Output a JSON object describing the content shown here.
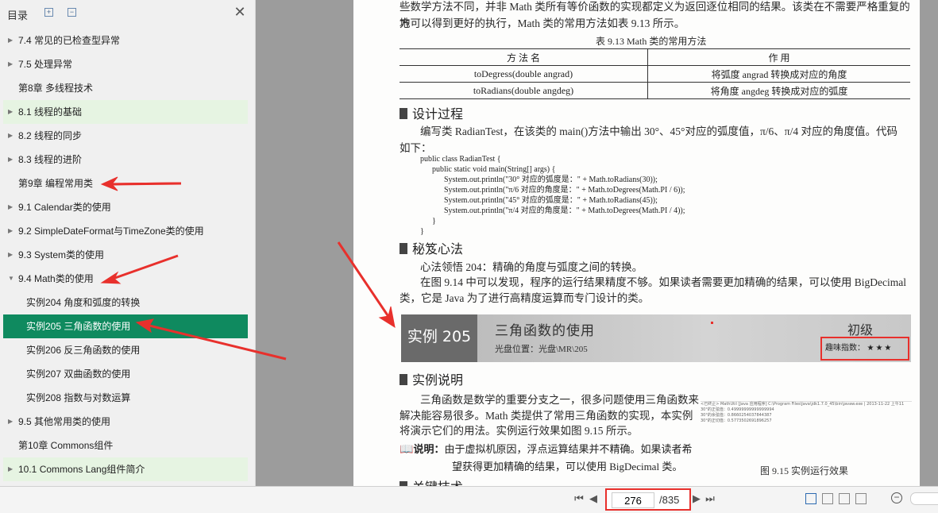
{
  "sidebar": {
    "title": "目录",
    "items": [
      {
        "label": "7.4 常见的已检查型异常",
        "level": 0,
        "caret": true,
        "style": ""
      },
      {
        "label": "7.5 处理异常",
        "level": 0,
        "caret": true,
        "style": ""
      },
      {
        "label": "第8章 多线程技术",
        "level": 0,
        "caret": false,
        "style": ""
      },
      {
        "label": "8.1 线程的基础",
        "level": 0,
        "caret": true,
        "style": "hl"
      },
      {
        "label": "8.2 线程的同步",
        "level": 0,
        "caret": true,
        "style": ""
      },
      {
        "label": "8.3 线程的进阶",
        "level": 0,
        "caret": true,
        "style": ""
      },
      {
        "label": "第9章 编程常用类",
        "level": 0,
        "caret": false,
        "style": ""
      },
      {
        "label": "9.1 Calendar类的使用",
        "level": 0,
        "caret": true,
        "style": ""
      },
      {
        "label": "9.2 SimpleDateFormat与TimeZone类的使用",
        "level": 0,
        "caret": true,
        "style": ""
      },
      {
        "label": "9.3 System类的使用",
        "level": 0,
        "caret": true,
        "style": ""
      },
      {
        "label": "9.4 Math类的使用",
        "level": 0,
        "caret": true,
        "expanded": true,
        "style": ""
      },
      {
        "label": "实例204 角度和弧度的转换",
        "level": 1,
        "caret": false,
        "style": ""
      },
      {
        "label": "实例205 三角函数的使用",
        "level": 1,
        "caret": false,
        "style": "sel"
      },
      {
        "label": "实例206 反三角函数的使用",
        "level": 1,
        "caret": false,
        "style": ""
      },
      {
        "label": "实例207 双曲函数的使用",
        "level": 1,
        "caret": false,
        "style": ""
      },
      {
        "label": "实例208 指数与对数运算",
        "level": 1,
        "caret": false,
        "style": ""
      },
      {
        "label": "9.5 其他常用类的使用",
        "level": 0,
        "caret": true,
        "style": ""
      },
      {
        "label": "第10章 Commons组件",
        "level": 0,
        "caret": false,
        "style": ""
      },
      {
        "label": "10.1 Commons Lang组件简介",
        "level": 0,
        "caret": true,
        "style": "hl"
      },
      {
        "label": "10.2 Commons Math组件简介",
        "level": 0,
        "caret": true,
        "style": ""
      }
    ]
  },
  "doc": {
    "intro_line1": "些数学方法不同，并非 Math 类所有等价函数的实现都定义为返回逐位相同的结果。该类在不需要严格重复的地",
    "intro_line2": "方可以得到更好的执行，Math 类的常用方法如表 9.13 所示。",
    "table_caption": "表 9.13    Math 类的常用方法",
    "table_head": [
      "方 法 名",
      "作 用"
    ],
    "table_rows": [
      [
        "toDegress(double angrad)",
        "将弧度 angrad 转换成对应的角度"
      ],
      [
        "toRadians(double angdeg)",
        "将角度 angdeg 转换成对应的弧度"
      ]
    ],
    "h_design": "设计过程",
    "design_line1": "编写类 RadianTest，在该类的 main()方法中输出 30°、45°对应的弧度值，π/6、π/4 对应的角度值。代码",
    "design_line2": "如下：",
    "code": "public class RadianTest {\n      public static void main(String[] args) {\n            System.out.println(\"30° 对应的弧度是：\" + Math.toRadians(30));\n            System.out.println(\"π/6 对应的角度是：\" + Math.toDegrees(Math.PI / 6));\n            System.out.println(\"45° 对应的弧度是：\" + Math.toRadians(45));\n            System.out.println(\"π/4 对应的角度是：\" + Math.toDegrees(Math.PI / 4));\n      }\n}",
    "h_tips": "秘笈心法",
    "tips_line1": "心法领悟 204：精确的角度与弧度之间的转换。",
    "tips_line2": "在图 9.14 中可以发现，程序的运行结果精度不够。如果读者需要更加精确的结果，可以使用 BigDecimal",
    "tips_line3": "类，它是 Java 为了进行高精度运算而专门设计的类。",
    "banner_id": "实例 205",
    "banner_title": "三角函数的使用",
    "banner_location": "光盘位置：光盘\\MR\\205",
    "banner_level": "初级",
    "banner_fun_label": "趣味指数：",
    "banner_fun_stars": "★★★",
    "h_desc": "实例说明",
    "desc_line1": "三角函数是数学的重要分支之一，很多问题使用三角函数来",
    "desc_line2": "解决能容易很多。Math 类提供了常用三角函数的实现，本实例",
    "desc_line3": "将演示它们的用法。实例运行效果如图 9.15 所示。",
    "note_label": "说明：",
    "note_line1": "由于虚拟机原因，浮点运算结果并不精确。如果读者希",
    "note_line2": "望获得更加精确的结果，可以使用 BigDecimal 类。",
    "fig_caption": "图 9.15    实例运行效果",
    "fig_console": [
      "<已终止> MathUtil [Java 应用程序] C:\\Program Files\\Java\\jdk1.7.0_45\\bin\\javaw.exe | 2013-11-22 上午11",
      "30°的正弦值：0.49999999999999994",
      "30°的余弦值：0.8660254037844387",
      "30°的正切值：0.5773502691896257"
    ],
    "h_key": "关键技术"
  },
  "bottom": {
    "page_current": "276",
    "page_total": "/835"
  },
  "colors": {
    "selected_bg": "#0f8a5f",
    "highlight_bg": "#e6f4e2",
    "annotation_red": "#e8302c"
  }
}
